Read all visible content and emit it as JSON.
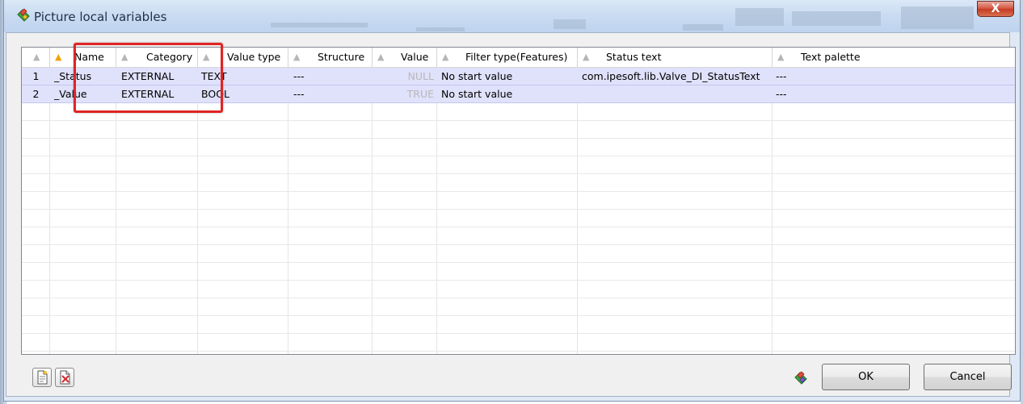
{
  "window": {
    "title": "Picture local variables",
    "close_label": "X"
  },
  "grid": {
    "columns": [
      "",
      "Name",
      "Category",
      "Value type",
      "Structure",
      "Value",
      "Filter type(Features)",
      "Status text",
      "Text palette"
    ],
    "sorted_column": "Name",
    "rows": [
      {
        "num": "1",
        "name": "_Status",
        "category": "EXTERNAL",
        "value_type": "TEXT",
        "structure": "---",
        "value": "NULL",
        "filter_type": "No start value",
        "status_text": "com.ipesoft.lib.Valve_DI_StatusText",
        "text_palette": "---"
      },
      {
        "num": "2",
        "name": "_Value",
        "category": "EXTERNAL",
        "value_type": "BOOL",
        "structure": "---",
        "value": "TRUE",
        "filter_type": "No start value",
        "status_text": "",
        "text_palette": "---"
      }
    ]
  },
  "footer": {
    "ok_label": "OK",
    "cancel_label": "Cancel"
  },
  "icons": {
    "title": "picture-variables-icon",
    "new_row": "new-document-icon",
    "delete_row": "delete-document-icon",
    "status": "variables-icon"
  },
  "colors": {
    "selected_row": "#e0e1fb",
    "highlight_box": "#e02424",
    "active_sort": "#f0a30a"
  }
}
